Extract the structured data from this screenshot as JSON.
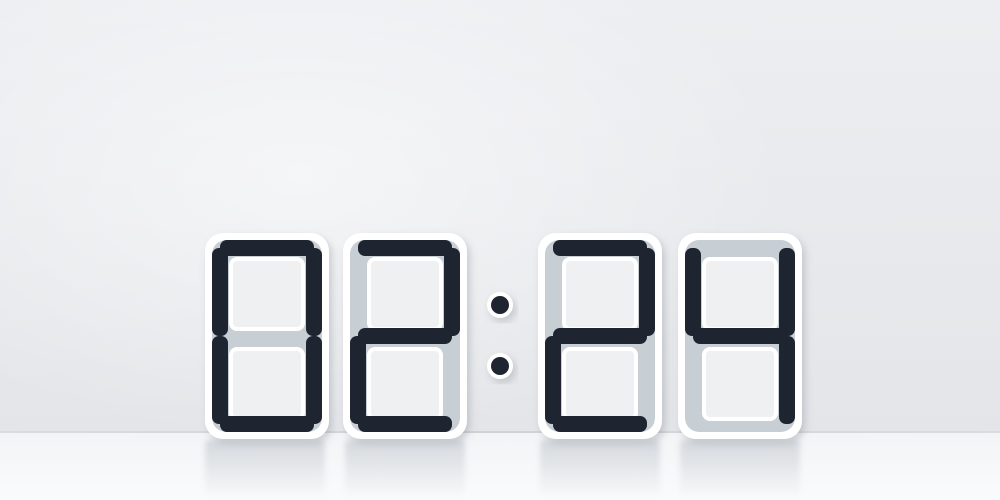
{
  "clock": {
    "time": "02:24",
    "digits": [
      "0",
      "2",
      "2",
      "4"
    ],
    "colors": {
      "active_segment": "#1e2530",
      "inactive_segment": "#c7cfd5",
      "frame": "#ffffff",
      "colon_dot": "#1e2530"
    }
  }
}
